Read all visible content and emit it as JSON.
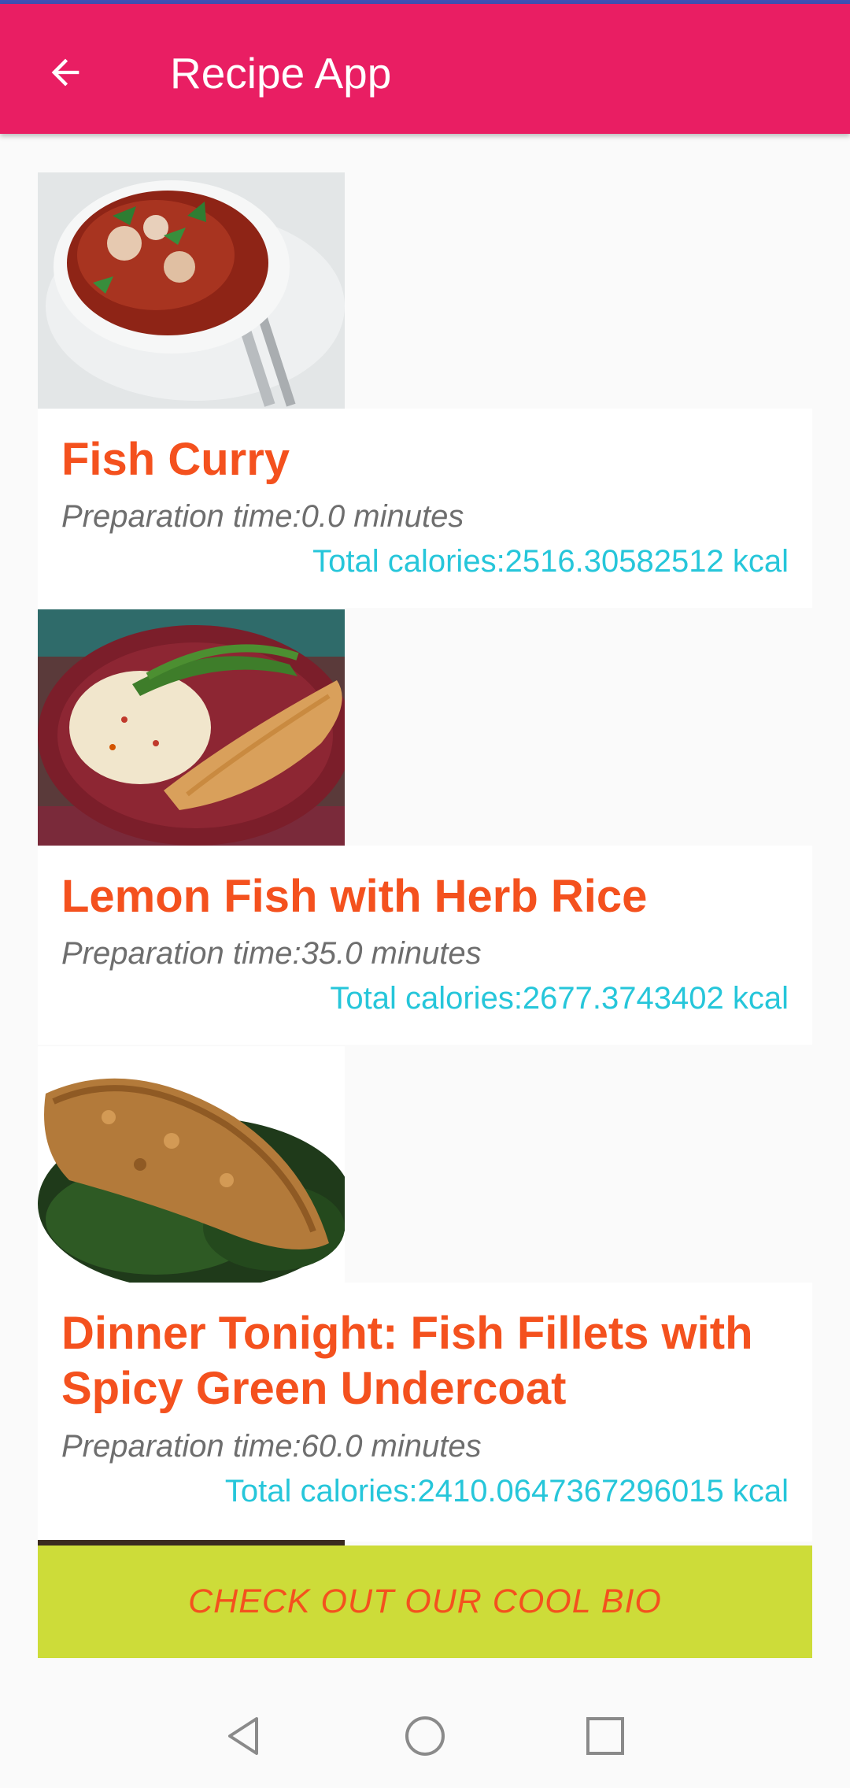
{
  "app": {
    "title": "Recipe App"
  },
  "recipes": [
    {
      "name": "Fish Curry",
      "prep": "Preparation time:0.0 minutes",
      "calories": "Total calories:2516.30582512 kcal"
    },
    {
      "name": "Lemon Fish with Herb Rice",
      "prep": "Preparation time:35.0 minutes",
      "calories": "Total calories:2677.3743402 kcal"
    },
    {
      "name": "Dinner Tonight: Fish Fillets with Spicy Green Undercoat",
      "prep": "Preparation time:60.0 minutes",
      "calories": "Total calories:2410.0647367296015 kcal"
    }
  ],
  "bio_button": {
    "label": "CHECK OUT OUR COOL BIO"
  },
  "colors": {
    "appbar": "#e91e63",
    "title": "#f4511e",
    "calories": "#26c6da",
    "bio_button": "#cddc39"
  }
}
